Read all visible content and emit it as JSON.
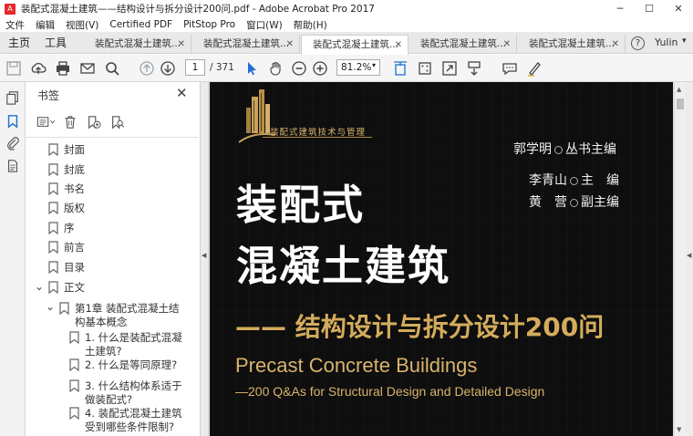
{
  "window": {
    "title": "装配式混凝土建筑——结构设计与拆分设计200问.pdf - Adobe Acrobat Pro 2017",
    "minimize": "─",
    "maximize": "☐",
    "close": "✕"
  },
  "menu": [
    "文件",
    "编辑",
    "视图(V)",
    "Certified PDF",
    "PitStop Pro",
    "窗口(W)",
    "帮助(H)"
  ],
  "tabs": {
    "home": "主页",
    "tools": "工具",
    "docs": [
      "装配式混凝土建筑...",
      "装配式混凝土建筑...",
      "装配式混凝土建筑...",
      "装配式混凝土建筑...",
      "装配式混凝土建筑..."
    ],
    "close_glyph": "✕",
    "help": "?",
    "user": "Yulin",
    "user_chevron": "▾"
  },
  "toolbar": {
    "page_current": "1",
    "page_total": "/ 371",
    "zoom": "81.2%",
    "zoom_chevron": "▾"
  },
  "sidepanel": {
    "title": "书签",
    "close_glyph": "✕",
    "bookmarks": [
      {
        "label": "封面",
        "level": 0
      },
      {
        "label": "封底",
        "level": 0
      },
      {
        "label": "书名",
        "level": 0
      },
      {
        "label": "版权",
        "level": 0
      },
      {
        "label": "序",
        "level": 0
      },
      {
        "label": "前言",
        "level": 0
      },
      {
        "label": "目录",
        "level": 0
      },
      {
        "label": "正文",
        "level": 0
      },
      {
        "label": "第1章 装配式混凝土结构基本概念",
        "level": 1
      },
      {
        "label": "1. 什么是装配式混凝土建筑?",
        "level": 2
      },
      {
        "label": "2. 什么是等同原理?",
        "level": 2
      },
      {
        "label": "3. 什么结构体系适于做装配式?",
        "level": 2
      },
      {
        "label": "4. 装配式混凝土建筑受到哪些条件限制?",
        "level": 2
      }
    ],
    "toggle_open": "⌄"
  },
  "cover": {
    "series": "装配式建筑技术与管理",
    "editor1_name": "郭学明",
    "editor1_role": "丛书主编",
    "editor2_name": "李青山",
    "editor2_role": "主　编",
    "editor3_name": "黄　营",
    "editor3_role": "副主编",
    "title_line1": "装配式",
    "title_line2": "混凝土建筑",
    "subtitle": "—— 结构设计与拆分设计200问",
    "en_title": "Precast Concrete Buildings",
    "en_subtitle": "—200 Q&As for Structural Design and Detailed Design"
  },
  "colors": {
    "cover_bg": "#0e0e0e",
    "cover_gold": "#d4ac5c",
    "toolbar_bg": "#f5f5f5"
  }
}
